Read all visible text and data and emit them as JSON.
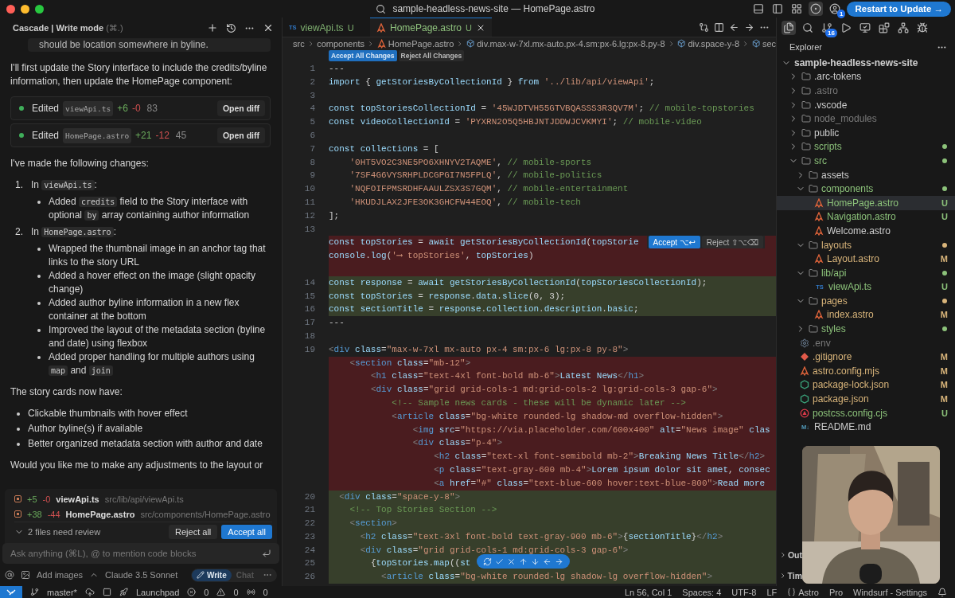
{
  "window": {
    "title": "sample-headless-news-site — HomePage.astro",
    "update_button": "Restart to Update →",
    "account_badge": "1"
  },
  "cascade": {
    "title": "Cascade | Write mode",
    "shortcut": "(⌘.)",
    "quoted": "should be location somewhere in byline.",
    "intro": "I'll first update the Story interface to include the credits/byline information, then update the HomePage component:",
    "edits": [
      {
        "verb": "Edited",
        "file": "viewApi.ts",
        "added": "+6",
        "removed": "-0",
        "count": "83",
        "button": "Open diff"
      },
      {
        "verb": "Edited",
        "file": "HomePage.astro",
        "added": "+21",
        "removed": "-12",
        "count": "45",
        "button": "Open diff"
      }
    ],
    "summary": "I've made the following changes:",
    "steps": [
      {
        "number": "1.",
        "parts": [
          {
            "t": "In "
          },
          {
            "code": "viewApi.ts"
          },
          {
            "t": ":"
          }
        ],
        "bullets": [
          [
            {
              "t": "Added "
            },
            {
              "code": "credits"
            },
            {
              "t": " field to the Story interface with optional "
            },
            {
              "code": "by"
            },
            {
              "t": " array containing author information"
            }
          ]
        ]
      },
      {
        "number": "2.",
        "parts": [
          {
            "t": "In "
          },
          {
            "code": "HomePage.astro"
          },
          {
            "t": ":"
          }
        ],
        "bullets": [
          [
            {
              "t": "Wrapped the thumbnail image in an anchor tag that links to the story URL"
            }
          ],
          [
            {
              "t": "Added a hover effect on the image (slight opacity change)"
            }
          ],
          [
            {
              "t": "Added author byline information in a new flex container at the bottom"
            }
          ],
          [
            {
              "t": "Improved the layout of the metadata section (byline and date) using flexbox"
            }
          ],
          [
            {
              "t": "Added proper handling for multiple authors using "
            },
            {
              "code": "map"
            },
            {
              "t": " and "
            },
            {
              "code": "join"
            }
          ]
        ]
      }
    ],
    "cards_intro": "The story cards now have:",
    "cards": [
      "Clickable thumbnails with hover effect",
      "Author byline(s) if available",
      "Better organized metadata section with author and date"
    ],
    "question": "Would you like me to make any adjustments to the layout or",
    "review": {
      "files": [
        {
          "added": "+5",
          "removed": "-0",
          "file": "viewApi.ts",
          "path": "src/lib/api/viewApi.ts"
        },
        {
          "added": "+38",
          "removed": "-44",
          "file": "HomePage.astro",
          "path": "src/components/HomePage.astro"
        }
      ],
      "summary": "2 files need review",
      "reject": "Reject all",
      "accept": "Accept all"
    },
    "input": {
      "placeholder": "Ask anything (⌘L), @ to mention code blocks"
    },
    "toolbar": {
      "images": "Add images",
      "model": "Claude 3.5 Sonnet",
      "modes": [
        {
          "label": "Write",
          "selected": true
        },
        {
          "label": "Chat",
          "selected": false
        }
      ]
    }
  },
  "editor": {
    "tabs": [
      {
        "kind": "ts",
        "badge": "TS",
        "label": "viewApi.ts",
        "status": "U",
        "selected": false
      },
      {
        "kind": "astro",
        "label": "HomePage.astro",
        "status": "U",
        "selected": true
      }
    ],
    "breadcrumbs": [
      {
        "kind": "folder",
        "label": "src"
      },
      {
        "kind": "folder",
        "label": "components"
      },
      {
        "kind": "astro",
        "label": "HomePage.astro"
      },
      {
        "kind": "element",
        "label": "div.max-w-7xl.mx-auto.px-4.sm:px-6.lg:px-8.py-8"
      },
      {
        "kind": "element",
        "label": "div.space-y-8"
      },
      {
        "kind": "element",
        "label": "sec"
      }
    ],
    "accept_all": "Accept All Changes",
    "reject_all": "Reject All Changes",
    "inline_accept": "Accept ⌥↩",
    "inline_reject": "Reject ⇧⌥⌫",
    "lines": [
      {
        "n": "1",
        "text": "---",
        "kind": "context"
      },
      {
        "n": "2",
        "text": "import { getStoriesByCollectionId } from '../lib/api/viewApi';",
        "kind": "context"
      },
      {
        "n": "3",
        "kind": "context"
      },
      {
        "n": "4",
        "text": "const topStoriesCollectionId = '45WJDTVH55GTVBQASSS3R3QV7M'; // mobile-topstories",
        "kind": "context"
      },
      {
        "n": "5",
        "text": "const videoCollectionId = 'PYXRN2O5Q5HBJNTJDDWJCVKMYI'; // mobile-video",
        "kind": "context"
      },
      {
        "n": "6",
        "kind": "context"
      },
      {
        "n": "7",
        "text": "const collections = [",
        "kind": "context"
      },
      {
        "n": "8",
        "text": "    '0HT5VO2C3NE5PO6XHNYV2TAQME', // mobile-sports",
        "kind": "context"
      },
      {
        "n": "9",
        "text": "    '7SF4G6VYSRHPLDCGPGI7N5FPLQ', // mobile-politics",
        "kind": "context"
      },
      {
        "n": "10",
        "text": "    'NQFOIFPMSRDHFAAULZSX3S7GQM', // mobile-entertainment",
        "kind": "context"
      },
      {
        "n": "11",
        "text": "    'HKUDJLAX2JFE3OK3GHCFW44EOQ', // mobile-tech",
        "kind": "context"
      },
      {
        "n": "12",
        "text": "];",
        "kind": "context"
      },
      {
        "n": "13",
        "kind": "context"
      },
      {
        "text": "const topStories = await getStoriesByCollectionId(topStorie",
        "kind": "removed",
        "widget": true
      },
      {
        "text": "console.log('⟶ topStories', topStories)",
        "kind": "removed"
      },
      {
        "kind": "removed"
      },
      {
        "n": "14",
        "text": "const response = await getStoriesByCollectionId(topStoriesCollectionId);",
        "kind": "added"
      },
      {
        "n": "15",
        "text": "const topStories = response.data.slice(0, 3);",
        "kind": "added"
      },
      {
        "n": "16",
        "text": "const sectionTitle = response.collection.description.basic;",
        "kind": "added"
      },
      {
        "n": "17",
        "text": "---",
        "kind": "context"
      },
      {
        "n": "18",
        "kind": "context"
      },
      {
        "n": "19",
        "text": "<div class=\"max-w-7xl mx-auto px-4 sm:px-6 lg:px-8 py-8\">",
        "kind": "context"
      },
      {
        "text": "    <section class=\"mb-12\">",
        "kind": "removed"
      },
      {
        "text": "        <h1 class=\"text-4xl font-bold mb-6\">Latest News</h1>",
        "kind": "removed"
      },
      {
        "text": "        <div class=\"grid grid-cols-1 md:grid-cols-2 lg:grid-cols-3 gap-6\">",
        "kind": "removed"
      },
      {
        "text": "            <!-- Sample news cards - these will be dynamic later -->",
        "kind": "removed"
      },
      {
        "text": "            <article class=\"bg-white rounded-lg shadow-md overflow-hidden\">",
        "kind": "removed"
      },
      {
        "text": "                <img src=\"https://via.placeholder.com/600x400\" alt=\"News image\" clas",
        "kind": "removed"
      },
      {
        "text": "                <div class=\"p-4\">",
        "kind": "removed"
      },
      {
        "text": "                    <h2 class=\"text-xl font-semibold mb-2\">Breaking News Title</h2>",
        "kind": "removed"
      },
      {
        "text": "                    <p class=\"text-gray-600 mb-4\">Lorem ipsum dolor sit amet, consec",
        "kind": "removed"
      },
      {
        "text": "                    <a href=\"#\" class=\"text-blue-600 hover:text-blue-800\">Read more",
        "kind": "removed"
      },
      {
        "n": "20",
        "text": "  <div class=\"space-y-8\">",
        "kind": "added"
      },
      {
        "n": "21",
        "text": "    <!-- Top Stories Section -->",
        "kind": "added"
      },
      {
        "n": "22",
        "text": "    <section>",
        "kind": "added"
      },
      {
        "n": "23",
        "text": "      <h2 class=\"text-3xl font-bold text-gray-900 mb-6\">{sectionTitle}</h2>",
        "kind": "added"
      },
      {
        "n": "24",
        "text": "      <div class=\"grid grid-cols-1 md:grid-cols-3 gap-6\">",
        "kind": "added"
      },
      {
        "n": "25",
        "text": "        {topStories.map((st",
        "kind": "added"
      },
      {
        "n": "26",
        "text": "          <article class=\"bg-white rounded-lg shadow-lg overflow-hidden\">",
        "kind": "added"
      }
    ]
  },
  "explorer": {
    "title": "Explorer",
    "scm_badge": "16",
    "tree": [
      {
        "name": "sample-headless-news-site",
        "kind": "root",
        "expanded": true,
        "color": "#d0d0d0",
        "selected": false,
        "children": [
          {
            "name": ".arc-tokens",
            "kind": "folder",
            "expanded": false,
            "color": "#cccccc",
            "selected": false
          },
          {
            "name": ".astro",
            "kind": "folder",
            "expanded": false,
            "color": "#7a7a7a",
            "selected": false
          },
          {
            "name": ".vscode",
            "kind": "folder",
            "expanded": false,
            "color": "#cccccc",
            "selected": false
          },
          {
            "name": "node_modules",
            "kind": "folder",
            "expanded": false,
            "color": "#7a7a7a",
            "selected": false
          },
          {
            "name": "public",
            "kind": "folder",
            "expanded": false,
            "color": "#cccccc",
            "selected": false
          },
          {
            "name": "scripts",
            "kind": "folder",
            "expanded": false,
            "color": "#8cc27a",
            "dot": true,
            "selected": false
          },
          {
            "name": "src",
            "kind": "folder",
            "expanded": true,
            "color": "#8cc27a",
            "dot": true,
            "selected": false,
            "children": [
              {
                "name": "assets",
                "kind": "folder",
                "expanded": false,
                "color": "#cccccc",
                "selected": false
              },
              {
                "name": "components",
                "kind": "folder",
                "expanded": true,
                "color": "#8cc27a",
                "dot": true,
                "selected": false,
                "children": [
                  {
                    "name": "HomePage.astro",
                    "kind": "astro",
                    "color": "#8cc27a",
                    "status": "U",
                    "selected": true
                  },
                  {
                    "name": "Navigation.astro",
                    "kind": "astro",
                    "color": "#8cc27a",
                    "status": "U",
                    "selected": false
                  },
                  {
                    "name": "Welcome.astro",
                    "kind": "astro",
                    "color": "#cccccc",
                    "selected": false
                  }
                ]
              },
              {
                "name": "layouts",
                "kind": "folder",
                "expanded": true,
                "color": "#d8b47a",
                "dot": true,
                "selected": false,
                "children": [
                  {
                    "name": "Layout.astro",
                    "kind": "astro",
                    "color": "#d8b47a",
                    "status": "M",
                    "selected": false
                  }
                ]
              },
              {
                "name": "lib/api",
                "kind": "folder",
                "expanded": true,
                "color": "#8cc27a",
                "dot": true,
                "selected": false,
                "children": [
                  {
                    "name": "viewApi.ts",
                    "kind": "ts",
                    "badge": "TS",
                    "color": "#8cc27a",
                    "status": "U",
                    "selected": false
                  }
                ]
              },
              {
                "name": "pages",
                "kind": "folder",
                "expanded": true,
                "color": "#d8b47a",
                "dot": true,
                "selected": false,
                "children": [
                  {
                    "name": "index.astro",
                    "kind": "astro",
                    "color": "#d8b47a",
                    "status": "M",
                    "selected": false
                  }
                ]
              },
              {
                "name": "styles",
                "kind": "folder",
                "expanded": false,
                "color": "#8cc27a",
                "dot": true,
                "selected": false
              }
            ]
          },
          {
            "name": ".env",
            "kind": "env",
            "color": "#7a7a7a",
            "selected": false
          },
          {
            "name": ".gitignore",
            "kind": "git",
            "color": "#d8b47a",
            "status": "M",
            "selected": false
          },
          {
            "name": "astro.config.mjs",
            "kind": "astro",
            "color": "#d8b47a",
            "status": "M",
            "selected": false
          },
          {
            "name": "package-lock.json",
            "kind": "json",
            "color": "#d8b47a",
            "status": "M",
            "selected": false
          },
          {
            "name": "package.json",
            "kind": "json",
            "color": "#d8b47a",
            "status": "M",
            "selected": false
          },
          {
            "name": "postcss.config.cjs",
            "kind": "postcss",
            "color": "#8cc27a",
            "status": "U",
            "selected": false
          },
          {
            "name": "README.md",
            "kind": "markdown",
            "badge": "M↓",
            "color": "#cccccc",
            "selected": false
          }
        ]
      }
    ],
    "sections": [
      "Out",
      "Tim"
    ]
  },
  "status_bar": {
    "branch": "master*",
    "launchpad": "Launchpad",
    "errors": "0",
    "warnings": "0",
    "ports": "0",
    "right": [
      {
        "kind": "text",
        "label": "Ln 56, Col 1"
      },
      {
        "kind": "text",
        "label": "Spaces: 4"
      },
      {
        "kind": "text",
        "label": "UTF-8"
      },
      {
        "kind": "text",
        "label": "LF"
      },
      {
        "kind": "language",
        "label": "Astro"
      },
      {
        "kind": "text",
        "label": "Pro"
      },
      {
        "kind": "text",
        "label": "Windsurf - Settings"
      }
    ]
  }
}
